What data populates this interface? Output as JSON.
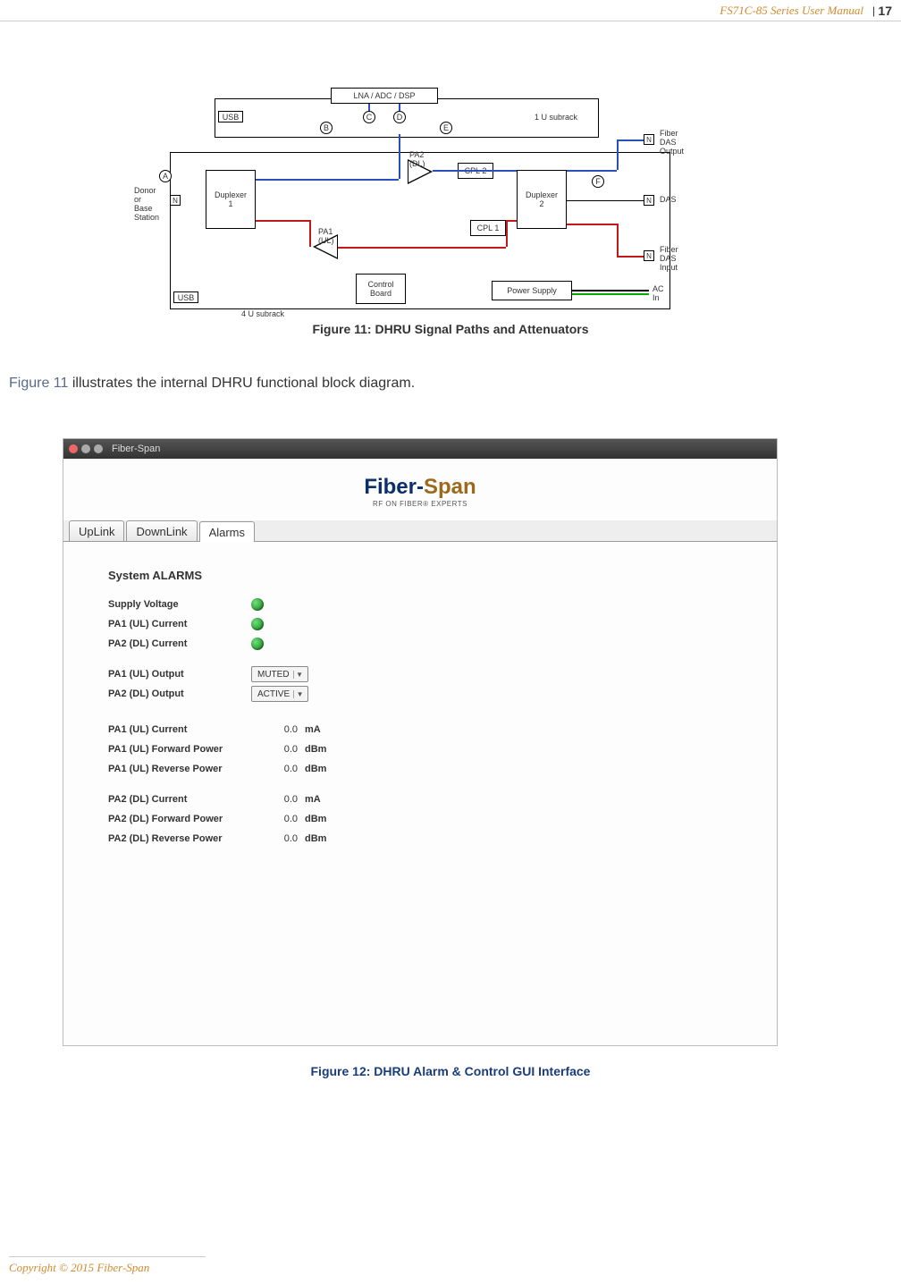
{
  "header": {
    "title": "FS71C-85 Series User Manual",
    "page": "17"
  },
  "fig11": {
    "caption": "Figure 11: DHRU Signal Paths and Attenuators",
    "labels": {
      "lna": "LNA / ADC / DSP",
      "usb": "USB",
      "subrack1": "1 U subrack",
      "subrack4": "4 U subrack",
      "donor": "Donor\nor\nBase\nStation",
      "dup1": "Duplexer\n1",
      "dup2": "Duplexer\n2",
      "pa1": "PA1\n(UL)",
      "pa2": "PA2\n(DL)",
      "cpl1": "CPL 1",
      "cpl2": "CPL 2",
      "ctrl": "Control\nBoard",
      "psu": "Power Supply",
      "fiber_out": "Fiber\nDAS\nOutput",
      "das": "DAS",
      "fiber_in": "Fiber\nDAS\nInput",
      "acin": "AC\nIn",
      "A": "A",
      "B": "B",
      "C": "C",
      "D": "D",
      "E": "E",
      "F": "F",
      "N": "N"
    }
  },
  "body": {
    "figref": "Figure 11",
    "text": " illustrates the internal DHRU functional block diagram."
  },
  "fig12": {
    "caption": "Figure 12:  DHRU Alarm & Control GUI Interface",
    "window_title": "Fiber-Span",
    "logo_a": "Fiber-",
    "logo_b": "Span",
    "tagline": "RF ON FIBER® EXPERTS",
    "tabs": [
      "UpLink",
      "DownLink",
      "Alarms"
    ],
    "active_tab": 2,
    "section_title": "System ALARMS",
    "leds": [
      {
        "label": "Supply Voltage"
      },
      {
        "label": "PA1 (UL) Current"
      },
      {
        "label": "PA2 (DL) Current"
      }
    ],
    "selects": [
      {
        "label": "PA1 (UL) Output",
        "value": "MUTED"
      },
      {
        "label": "PA2 (DL) Output",
        "value": "ACTIVE"
      }
    ],
    "readouts_a": [
      {
        "label": "PA1 (UL) Current",
        "value": "0.0",
        "unit": "mA"
      },
      {
        "label": "PA1 (UL) Forward Power",
        "value": "0.0",
        "unit": "dBm"
      },
      {
        "label": "PA1 (UL) Reverse Power",
        "value": "0.0",
        "unit": "dBm"
      }
    ],
    "readouts_b": [
      {
        "label": "PA2 (DL) Current",
        "value": "0.0",
        "unit": "mA"
      },
      {
        "label": "PA2 (DL) Forward Power",
        "value": "0.0",
        "unit": "dBm"
      },
      {
        "label": "PA2 (DL) Reverse Power",
        "value": "0.0",
        "unit": "dBm"
      }
    ]
  },
  "footer": "Copyright © 2015 Fiber-Span"
}
